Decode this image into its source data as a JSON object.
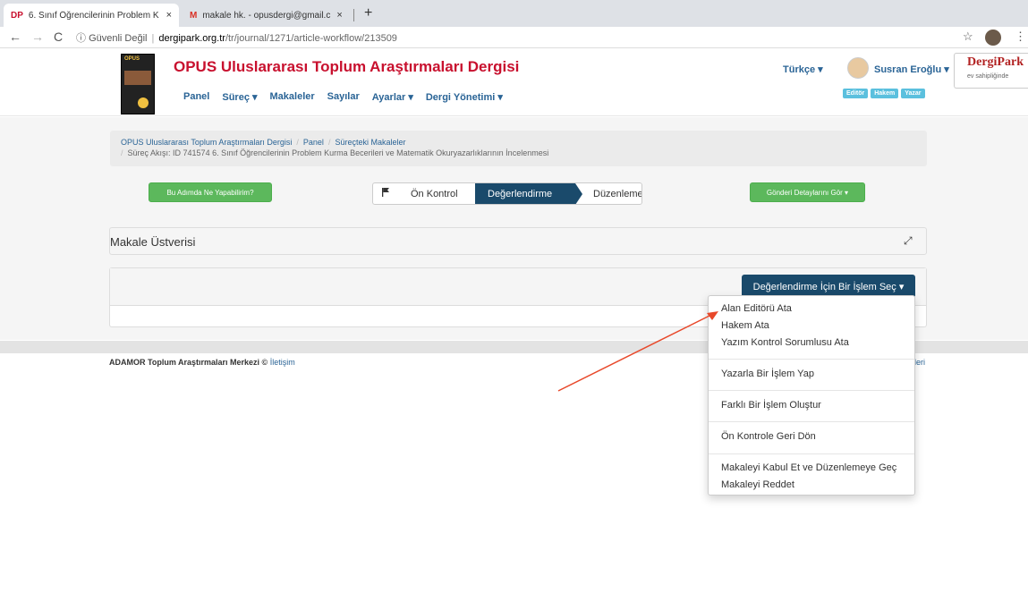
{
  "browser": {
    "tabs": [
      {
        "favicon": "DP",
        "title": "6. Sınıf Öğrencilerinin Problem K",
        "close": "×"
      },
      {
        "favicon": "M",
        "title": "makale hk. - opusdergi@gmail.c",
        "close": "×"
      }
    ],
    "new_tab": "+",
    "nav": {
      "back": "←",
      "forward": "→",
      "reload": "C"
    },
    "url": {
      "secure_icon": "ⓘ",
      "security_text": "Güvenli Değil",
      "host": "dergipark.org.tr",
      "path": "/tr/journal/1271/article-workflow/213509"
    },
    "star": "☆",
    "menu": "⋮"
  },
  "site": {
    "logo_text": "OPUS",
    "title": "OPUS Uluslararası Toplum Araştırmaları Dergisi",
    "nav": [
      "Panel",
      "Süreç ▾",
      "Makaleler",
      "Sayılar",
      "Ayarlar ▾",
      "Dergi Yönetimi ▾"
    ],
    "language": "Türkçe ▾",
    "username": "Susran Eroğlu ▾",
    "roles": [
      "Editör",
      "Hakem",
      "Yazar"
    ],
    "brand": {
      "name": "DergiPark",
      "tagline": "ev sahipliğinde"
    }
  },
  "breadcrumb": {
    "items": [
      "OPUS Uluslararası Toplum Araştırmaları Dergisi",
      "Panel",
      "Süreçteki Makaleler"
    ],
    "current": "Süreç Akışı: ID 741574 6. Sınıf Öğrencilerinin Problem Kurma Becerileri ve Matematik Okuryazarlıklarının İncelenmesi",
    "separator": "/"
  },
  "actions": {
    "help_button": "Bu Adımda Ne Yapabilirim?",
    "details_button": "Gönderi Detaylarını Gör ▾"
  },
  "workflow_steps": [
    {
      "label": "Ön Kontrol",
      "active": false
    },
    {
      "label": "Değerlendirme",
      "active": true
    },
    {
      "label": "Düzenleme",
      "active": false
    }
  ],
  "panel": {
    "title": "Makale Üstverisi",
    "expand_icon": "⤢"
  },
  "action_button": "Değerlendirme İçin Bir İşlem Seç ▾",
  "dropdown": {
    "groups": [
      [
        "Alan Editörü Ata",
        "Hakem Ata",
        "Yazım Kontrol Sorumlusu Ata"
      ],
      [
        "Yazarla Bir İşlem Yap"
      ],
      [
        "Farklı Bir İşlem Oluştur"
      ],
      [
        "Ön Kontrole Geri Dön"
      ],
      [
        "Makaleyi Kabul Et ve Düzenlemeye Geç",
        "Makaleyi Reddet"
      ]
    ]
  },
  "footer": {
    "text": "ADAMOR Toplum Araştırmaları Merkezi ©",
    "link": "İletişim",
    "right_link_fragment": "leri"
  },
  "colors": {
    "brand_red": "#c8102e",
    "link_blue": "#2a6496",
    "active_step": "#1a4a6b",
    "button_green": "#5cb85c",
    "role_badge": "#5bc0de",
    "annotation_arrow": "#e8482a"
  }
}
